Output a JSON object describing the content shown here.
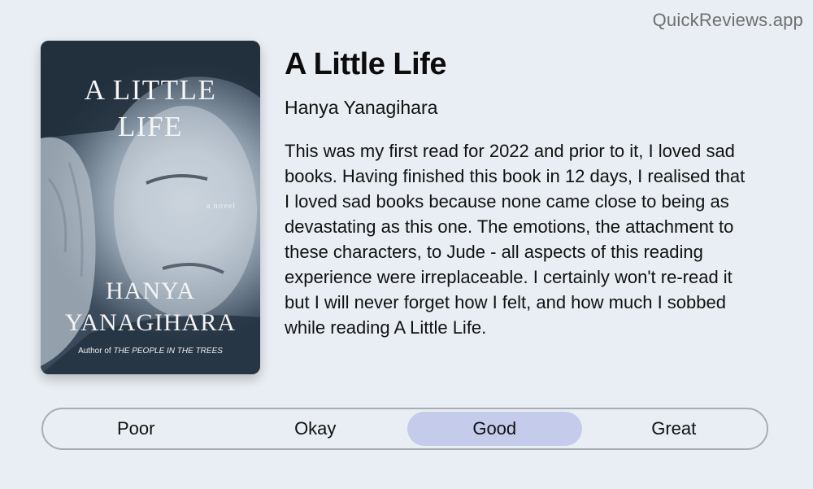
{
  "brand": "QuickReviews.app",
  "cover": {
    "title": "A LITTLE\nLIFE",
    "subtitle": "a novel",
    "author": "HANYA\nYANAGIHARA",
    "credit_prefix": "Author of ",
    "credit_work": "THE PEOPLE IN THE TREES"
  },
  "book": {
    "title": "A Little Life",
    "author": "Hanya Yanagihara"
  },
  "review": "This was my first read for 2022 and prior to it, I loved sad books. Having finished this book in 12 days, I realised that I loved sad books because none came close to being as devastating as this one. The emotions, the attachment to these characters, to Jude - all aspects of this reading experience were irreplaceable. I certainly won't re-read it but I will never forget how I felt, and how much I sobbed while reading A Little Life.",
  "rating": {
    "options": [
      "Poor",
      "Okay",
      "Good",
      "Great"
    ],
    "selected": "Good",
    "selected_color": "#c5cbeb"
  }
}
